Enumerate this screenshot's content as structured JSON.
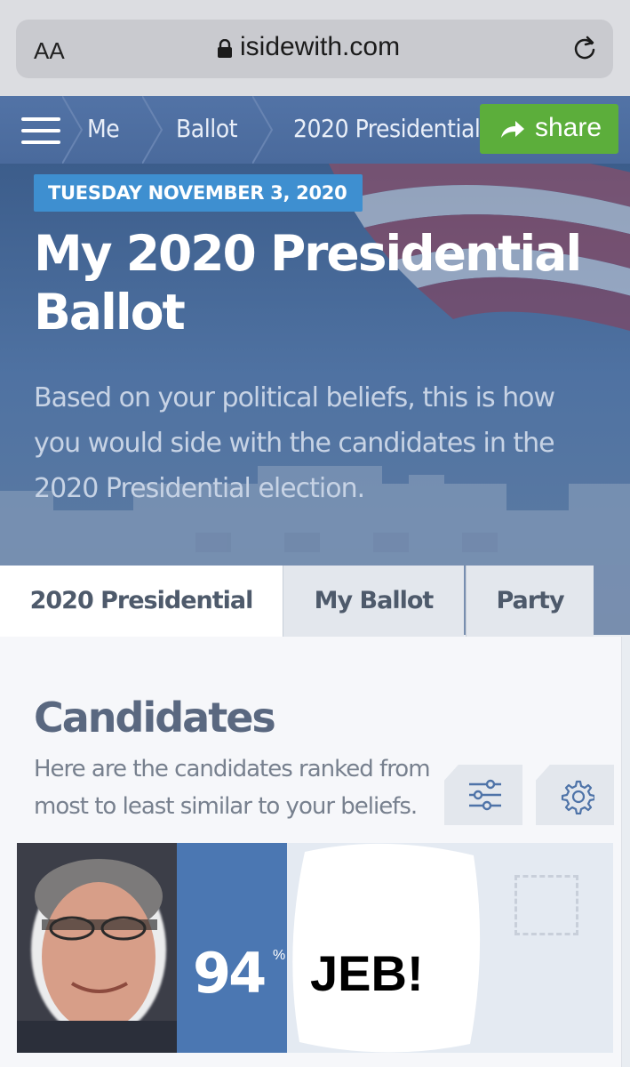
{
  "browser": {
    "text_size_label": "AA",
    "url": "isidewith.com"
  },
  "nav": {
    "breadcrumbs": [
      "Me",
      "Ballot",
      "2020 Presidential"
    ],
    "share_label": "share"
  },
  "hero": {
    "date": "TUESDAY NOVEMBER 3, 2020",
    "title": "My 2020 Presidential Ballot",
    "subtitle": "Based on your political beliefs, this is how you would side with the candidates in the 2020 Presidential election."
  },
  "tabs": [
    "2020 Presidential",
    "My Ballot",
    "Party"
  ],
  "candidates": {
    "heading": "Candidates",
    "description": "Here are the candidates ranked from most to least similar to your beliefs.",
    "top": {
      "match_percent": "94",
      "percent_sign": "%",
      "name": "JEB!"
    }
  },
  "colors": {
    "nav": "#4a6a9c",
    "share": "#5cae3b",
    "date_badge": "#3e8fd0",
    "match": "#4b77b2"
  }
}
